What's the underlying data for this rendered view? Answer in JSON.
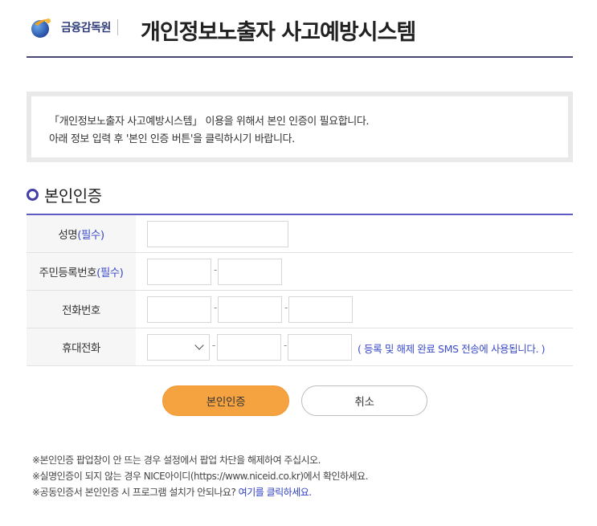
{
  "header": {
    "org_name": "금융감독원",
    "system_title": "개인정보노출자 사고예방시스템"
  },
  "notice": {
    "line1": "「개인정보노출자 사고예방시스템」 이용을 위해서 본인 인증이 필요합니다.",
    "line2": "아래 정보 입력 후 '본인 인증 버튼'을 클릭하시기 바랍니다."
  },
  "section": {
    "title": "본인인증"
  },
  "form": {
    "required_tag": "(필수)",
    "dash": "-",
    "name_label": "성명",
    "name_value": "",
    "rrn_label": "주민등록번호",
    "rrn_front": "",
    "rrn_back": "",
    "phone_label": "전화번호",
    "phone_1": "",
    "phone_2": "",
    "phone_3": "",
    "mobile_label": "휴대전화",
    "mobile_prefix_selected": "",
    "mobile_2": "",
    "mobile_3": "",
    "mobile_hint": "( 등록 및 해제 완료 SMS 전송에 사용됩니다. )"
  },
  "buttons": {
    "verify": "본인인증",
    "cancel": "취소"
  },
  "notes": {
    "line1": "※본인인증 팝업창이 안 뜨는 경우 설정에서 팝업 차단을 해제하여 주십시오.",
    "line2": "※실명인증이 되지 않는 경우 NICE아이디(https://www.niceid.co.kr)에서 확인하세요.",
    "line3_text": "※공동인증서 본인인증 시 프로그램 설치가 안되나요? ",
    "line3_link": "여기를 클릭하세요."
  },
  "colors": {
    "accent": "#5f5bc4",
    "button_primary": "#f5a240",
    "required": "#3b4bc9",
    "header_rule": "#4a4777"
  },
  "icons": {
    "logo": "fss-globe-logo",
    "section_marker": "ring-bullet-icon",
    "select_arrow": "chevron-down-icon"
  }
}
